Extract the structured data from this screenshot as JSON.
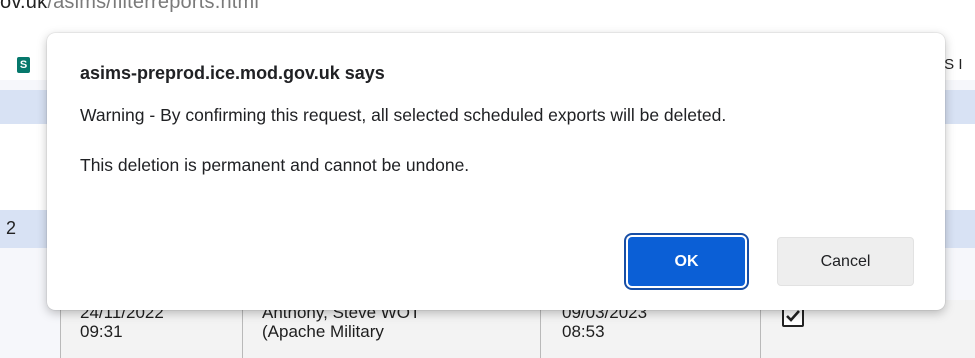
{
  "browser": {
    "url_domain": "ov.uk",
    "url_path": "/asims/filterreports.html"
  },
  "background_page": {
    "right_header_fragment": "IS I",
    "row_number": "2",
    "row": {
      "cell1": [
        "24/11/2022",
        "09:31"
      ],
      "cell2": [
        "Anthony, Steve WOT",
        "(Apache Military"
      ],
      "cell3": [
        "09/03/2023",
        "08:53"
      ],
      "checkbox_checked": true
    }
  },
  "dialog": {
    "title": "asims-preprod.ice.mod.gov.uk says",
    "message": "Warning - By confirming this request, all selected scheduled exports will be deleted.",
    "note": "This deletion is permanent and cannot be undone.",
    "ok_label": "OK",
    "cancel_label": "Cancel"
  },
  "colors": {
    "ok_button": "#0b5fd6",
    "row_highlight": "#d8e2f4",
    "sharepoint_icon": "#06786c"
  },
  "icons": {
    "app_icon": "sharepoint-icon",
    "checkbox": "checkmark-icon"
  }
}
